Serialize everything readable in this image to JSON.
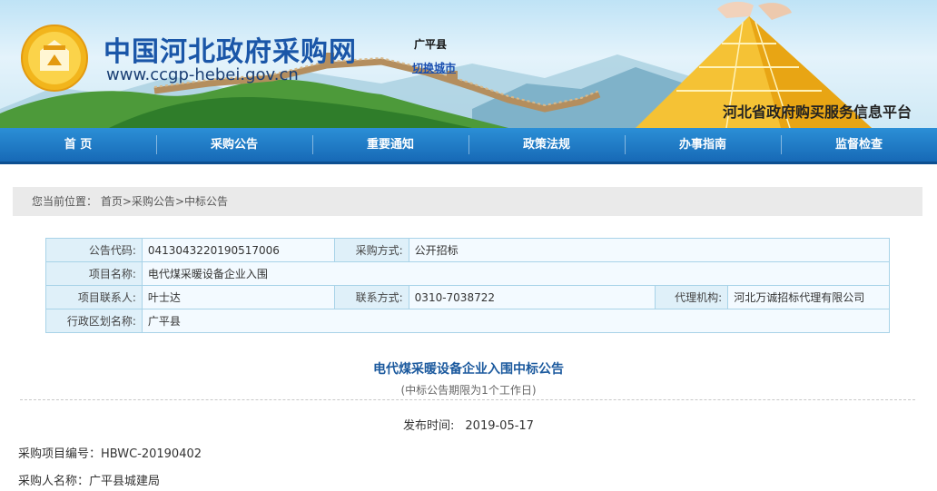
{
  "header": {
    "site_title": "中国河北政府采购网",
    "site_url": "www.ccgp-hebei.gov.cn",
    "county": "广平县",
    "switch_city": "切换城市",
    "platform": "河北省政府购买服务信息平台"
  },
  "nav": {
    "items": [
      "首 页",
      "采购公告",
      "重要通知",
      "政策法规",
      "办事指南",
      "监督检查"
    ]
  },
  "breadcrumb": {
    "label": "您当前位置：",
    "items": [
      "首页",
      "采购公告",
      "中标公告"
    ],
    "separator": ">"
  },
  "info": {
    "notice_code_key": "公告代码:",
    "notice_code": "0413043220190517006",
    "method_key": "采购方式:",
    "method": "公开招标",
    "project_name_key": "项目名称:",
    "project_name": "电代煤采暖设备企业入围",
    "contact_key": "项目联系人:",
    "contact": "叶士达",
    "phone_key": "联系方式:",
    "phone": "0310-7038722",
    "agency_key": "代理机构:",
    "agency": "河北万诚招标代理有限公司",
    "region_key": "行政区划名称:",
    "region": "广平县"
  },
  "notice": {
    "title": "电代煤采暖设备企业入围中标公告",
    "subtitle": "(中标公告期限为1个工作日)",
    "publish_label": "发布时间:",
    "publish_date": "2019-05-17",
    "project_no": "采购项目编号：HBWC-20190402",
    "purchaser": "采购人名称：广平县城建局"
  },
  "colors": {
    "nav_blue": "#1769b6",
    "title_blue": "#1a56a8",
    "logo_gold": "#f2b51c"
  }
}
